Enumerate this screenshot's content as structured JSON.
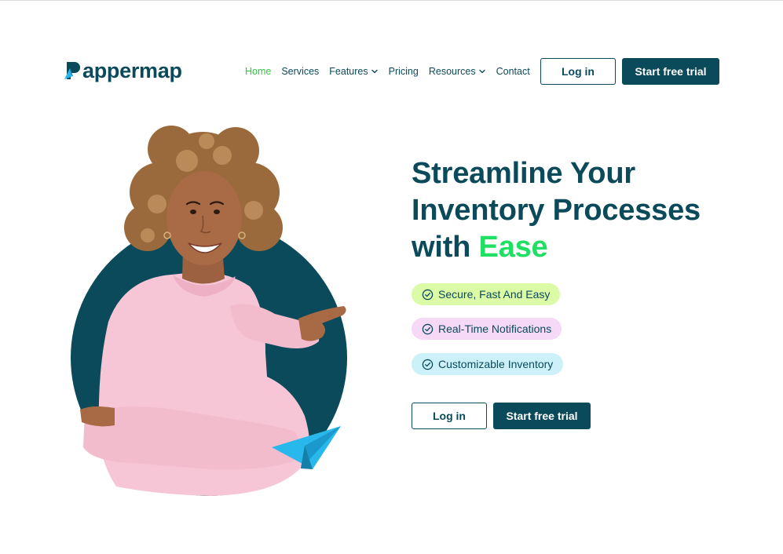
{
  "brand": {
    "name": "Pappermap",
    "name_rest": "appermap"
  },
  "nav": {
    "items": [
      {
        "label": "Home",
        "active": true,
        "has_dropdown": false
      },
      {
        "label": "Services",
        "active": false,
        "has_dropdown": false
      },
      {
        "label": "Features",
        "active": false,
        "has_dropdown": true
      },
      {
        "label": "Pricing",
        "active": false,
        "has_dropdown": false
      },
      {
        "label": "Resources",
        "active": false,
        "has_dropdown": true
      },
      {
        "label": "Contact",
        "active": false,
        "has_dropdown": false
      }
    ],
    "login_label": "Log in",
    "trial_label": "Start free trial"
  },
  "hero": {
    "headline_line1": "Streamline Your",
    "headline_line2": "Inventory Processes",
    "headline_with": "with ",
    "headline_accent": "Ease",
    "features": [
      {
        "label": "Secure, Fast And Easy",
        "color": "#dcfba6"
      },
      {
        "label": "Real-Time Notifications",
        "color": "#f5d9f7"
      },
      {
        "label": "Customizable Inventory",
        "color": "#cdf1f8"
      }
    ],
    "login_label": "Log in",
    "trial_label": "Start free trial"
  },
  "colors": {
    "brand_primary": "#0b4a5a",
    "accent_green": "#1fe063",
    "nav_active": "#2ecc40",
    "paper_plane": "#29b8ec"
  },
  "icons": {
    "logo": "paper-plane-logo-icon",
    "dropdown": "chevron-down-icon",
    "feature": "check-circle-icon"
  }
}
